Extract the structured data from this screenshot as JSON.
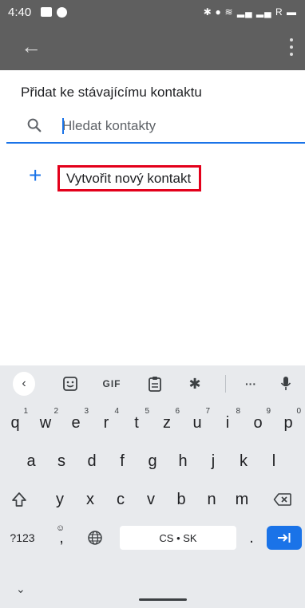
{
  "status_bar": {
    "time": "4:40",
    "right_icons": "✱ ⦁ ≋ ▂▄ ▂▄ R ▬"
  },
  "dialog": {
    "title": "Přidat ke stávajícímu kontaktu",
    "search": {
      "placeholder": "Hledat kontakty",
      "value": ""
    },
    "create_new_label": "Vytvořit nový kontakt"
  },
  "keyboard": {
    "toolbar": {
      "gif_label": "GIF",
      "more_label": "···"
    },
    "row1": [
      {
        "k": "q",
        "h": "1"
      },
      {
        "k": "w",
        "h": "2"
      },
      {
        "k": "e",
        "h": "3"
      },
      {
        "k": "r",
        "h": "4"
      },
      {
        "k": "t",
        "h": "5"
      },
      {
        "k": "z",
        "h": "6"
      },
      {
        "k": "u",
        "h": "7"
      },
      {
        "k": "i",
        "h": "8"
      },
      {
        "k": "o",
        "h": "9"
      },
      {
        "k": "p",
        "h": "0"
      }
    ],
    "row2": [
      "a",
      "s",
      "d",
      "f",
      "g",
      "h",
      "j",
      "k",
      "l"
    ],
    "row3": [
      "y",
      "x",
      "c",
      "v",
      "b",
      "n",
      "m"
    ],
    "symbols_label": "?123",
    "comma_label": ",",
    "space_label": "CS • SK",
    "period_label": "."
  },
  "colors": {
    "accent": "#1a73e8",
    "highlight": "#e3001b",
    "scrim": "#5f5f5f"
  }
}
